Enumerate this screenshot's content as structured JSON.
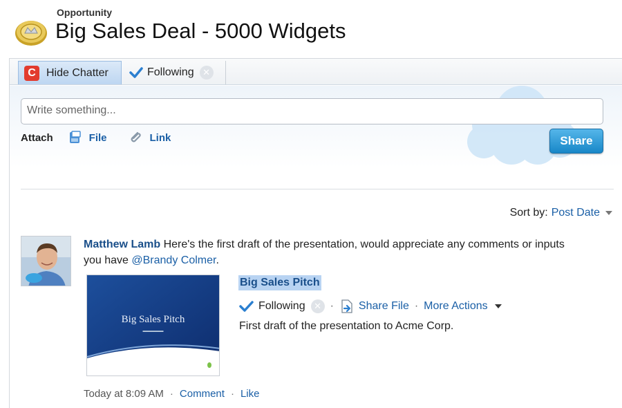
{
  "header": {
    "record_type": "Opportunity",
    "title": "Big Sales Deal - 5000 Widgets"
  },
  "tabs": {
    "hide_chatter": "Hide Chatter",
    "following": "Following"
  },
  "publisher": {
    "placeholder": "Write something...",
    "attach_label": "Attach",
    "file_label": "File",
    "link_label": "Link",
    "share_label": "Share"
  },
  "sort": {
    "label": "Sort by:",
    "value": "Post Date"
  },
  "post": {
    "author": "Matthew Lamb",
    "text": " Here's the first draft of the presentation, would appreciate any comments or inputs you have ",
    "mention": "@Brandy Colmer",
    "after_mention": ".",
    "file": {
      "title": "Big Sales Pitch",
      "thumbnail_title": "Big Sales Pitch",
      "following": "Following",
      "share_file": "Share File",
      "more_actions": "More Actions",
      "description": "First draft of the presentation to Acme Corp."
    },
    "meta": {
      "time": "Today at 8:09 AM",
      "comment": "Comment",
      "like": "Like"
    }
  },
  "colors": {
    "link": "#1a5fa6",
    "share_button": "#1887c8",
    "highlight": "#b8d3f2",
    "chatter_logo": "#e23b2e"
  },
  "icons": [
    "coin-icon",
    "chatter-icon",
    "check-icon",
    "close-icon",
    "file-icon",
    "paperclip-icon",
    "cloud-icon",
    "share-file-icon",
    "caret-down-icon"
  ]
}
